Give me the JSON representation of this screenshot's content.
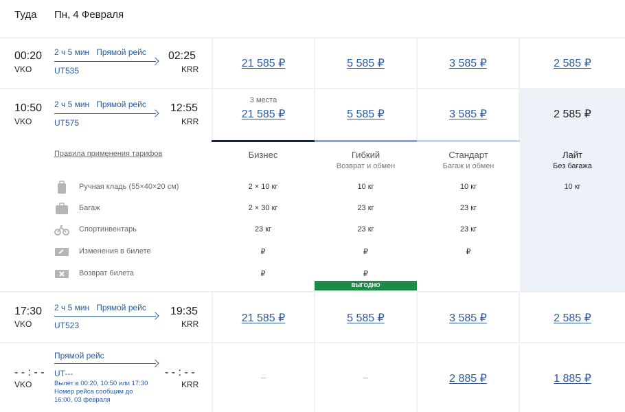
{
  "header": {
    "direction": "Туда",
    "date": "Пн, 4 Февраля"
  },
  "flights": [
    {
      "dep_time": "00:20",
      "dep_airport": "VKO",
      "duration": "2 ч 5 мин",
      "type": "Прямой рейс",
      "code": "UT535",
      "arr_time": "02:25",
      "arr_airport": "KRR",
      "prices": [
        "21 585 ₽",
        "5 585 ₽",
        "3 585 ₽",
        "2 585 ₽"
      ]
    },
    {
      "dep_time": "10:50",
      "dep_airport": "VKO",
      "duration": "2 ч 5 мин",
      "type": "Прямой рейс",
      "code": "UT575",
      "arr_time": "12:55",
      "arr_airport": "KRR",
      "seats_note": "3 места",
      "prices": [
        "21 585 ₽",
        "5 585 ₽",
        "3 585 ₽",
        "2 585 ₽"
      ]
    },
    {
      "dep_time": "17:30",
      "dep_airport": "VKO",
      "duration": "2 ч 5 мин",
      "type": "Прямой рейс",
      "code": "UT523",
      "arr_time": "19:35",
      "arr_airport": "KRR",
      "prices": [
        "21 585 ₽",
        "5 585 ₽",
        "3 585 ₽",
        "2 585 ₽"
      ]
    },
    {
      "dep_time": "- - : - -",
      "dep_airport": "VKO",
      "type": "Прямой рейс",
      "code": "UT---",
      "arr_time": "- - : - -",
      "arr_airport": "KRR",
      "note1": "Вылет в 00:20, 10:50 или 17:30",
      "note2": "Номер рейса сообщим до",
      "note3": "16:00, 03 февраля",
      "prices": [
        "–",
        "–",
        "2 885 ₽",
        "1 885 ₽"
      ]
    }
  ],
  "details": {
    "rules_link": "Правила применения тарифов",
    "features": [
      "Ручная кладь (55×40×20 см)",
      "Багаж",
      "Спортинвентарь",
      "Изменения в билете",
      "Возврат билета"
    ],
    "tariffs": [
      {
        "name": "Бизнес",
        "sub": "",
        "color": "#1b2430",
        "values": [
          "2 × 10 кг",
          "2 × 30 кг",
          "23 кг",
          "₽",
          "₽"
        ]
      },
      {
        "name": "Гибкий",
        "sub": "Возврат и обмен",
        "color": "#8fa5c4",
        "values": [
          "10 кг",
          "23 кг",
          "23 кг",
          "₽",
          "₽"
        ],
        "badge": "ВЫГОДНО"
      },
      {
        "name": "Стандарт",
        "sub": "Багаж и обмен",
        "color": "#c9d4e4",
        "values": [
          "10 кг",
          "23 кг",
          "23 кг",
          "₽",
          ""
        ]
      },
      {
        "name": "Лайт",
        "sub": "Без багажа",
        "color": "#edf2f8",
        "values": [
          "10 кг",
          "",
          "",
          "",
          ""
        ]
      }
    ]
  }
}
